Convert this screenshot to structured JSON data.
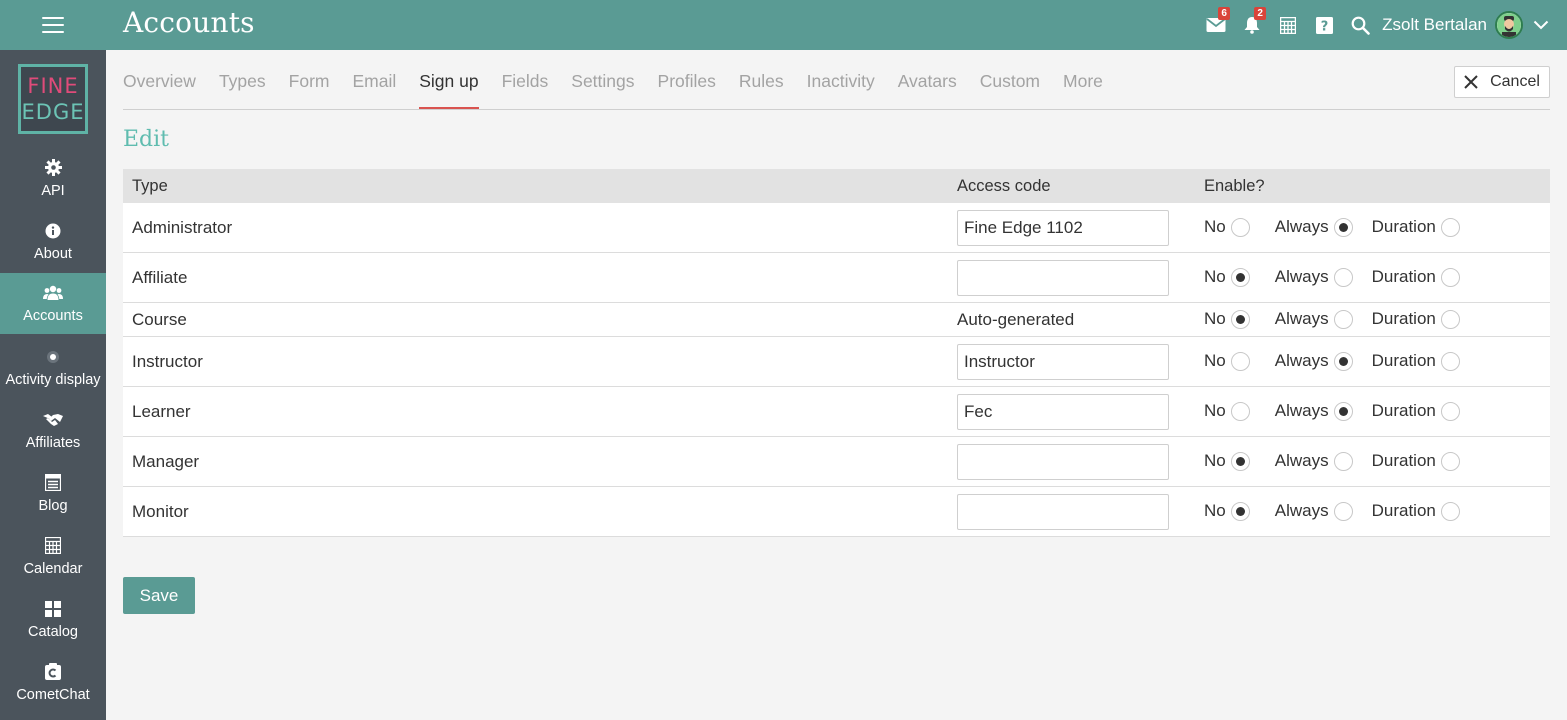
{
  "header": {
    "title": "Accounts",
    "mail_count": "6",
    "notification_count": "2",
    "user_name": "Zsolt Bertalan"
  },
  "logo": {
    "line1": "FINE",
    "line2": "EDGE"
  },
  "sidebar": {
    "items": [
      {
        "label": "API",
        "icon": "gear-icon"
      },
      {
        "label": "About",
        "icon": "info-icon"
      },
      {
        "label": "Accounts",
        "icon": "users-icon",
        "active": true
      },
      {
        "label": "Activity display",
        "icon": "dot-icon"
      },
      {
        "label": "Affiliates",
        "icon": "handshake-icon"
      },
      {
        "label": "Blog",
        "icon": "blog-icon"
      },
      {
        "label": "Calendar",
        "icon": "calendar-icon"
      },
      {
        "label": "Catalog",
        "icon": "grid-icon"
      },
      {
        "label": "CometChat",
        "icon": "chat-icon"
      }
    ]
  },
  "tabs": [
    {
      "label": "Overview"
    },
    {
      "label": "Types"
    },
    {
      "label": "Form"
    },
    {
      "label": "Email"
    },
    {
      "label": "Sign up",
      "active": true
    },
    {
      "label": "Fields"
    },
    {
      "label": "Settings"
    },
    {
      "label": "Profiles"
    },
    {
      "label": "Rules"
    },
    {
      "label": "Inactivity"
    },
    {
      "label": "Avatars"
    },
    {
      "label": "Custom"
    },
    {
      "label": "More"
    }
  ],
  "cancel_label": "Cancel",
  "section_title": "Edit",
  "table": {
    "headers": {
      "type": "Type",
      "access_code": "Access code",
      "enable": "Enable?"
    },
    "option_labels": {
      "no": "No",
      "always": "Always",
      "duration": "Duration"
    },
    "rows": [
      {
        "type": "Administrator",
        "access_code": "Fine Edge 1102",
        "editable": true,
        "enable": "always"
      },
      {
        "type": "Affiliate",
        "access_code": "",
        "editable": true,
        "enable": "no"
      },
      {
        "type": "Course",
        "access_code": "Auto-generated",
        "editable": false,
        "enable": "no"
      },
      {
        "type": "Instructor",
        "access_code": "Instructor",
        "editable": true,
        "enable": "always"
      },
      {
        "type": "Learner",
        "access_code": "Fec",
        "editable": true,
        "enable": "always"
      },
      {
        "type": "Manager",
        "access_code": "",
        "editable": true,
        "enable": "no"
      },
      {
        "type": "Monitor",
        "access_code": "",
        "editable": true,
        "enable": "no"
      }
    ]
  },
  "save_label": "Save",
  "colors": {
    "primary": "#5a9b94",
    "sidebar": "#4b545c",
    "accent_title": "#5fbcaf",
    "tab_underline": "#d9534f",
    "badge": "#d9443a"
  }
}
